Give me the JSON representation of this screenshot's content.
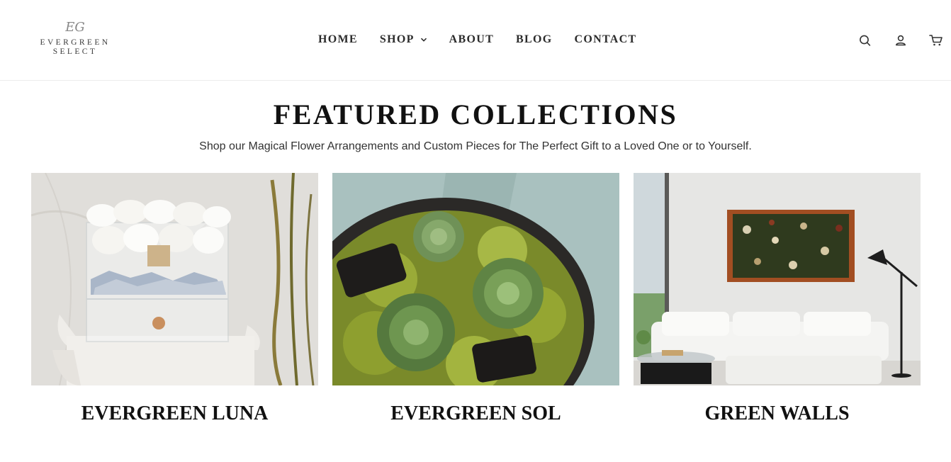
{
  "header": {
    "logo": {
      "monogram": "EG",
      "line1": "EVERGREEN",
      "line2": "SELECT"
    },
    "nav": [
      {
        "label": "HOME"
      },
      {
        "label": "SHOP"
      },
      {
        "label": "ABOUT"
      },
      {
        "label": "BLOG"
      },
      {
        "label": "CONTACT"
      }
    ],
    "icons": [
      "search-icon",
      "account-icon",
      "cart-icon"
    ]
  },
  "featured": {
    "title": "FEATURED COLLECTIONS",
    "subtitle": "Shop our Magical Flower Arrangements and Custom Pieces for The Perfect Gift to a Loved One or to Yourself.",
    "collections": [
      {
        "title": "EVERGREEN LUNA"
      },
      {
        "title": "EVERGREEN SOL"
      },
      {
        "title": "GREEN WALLS"
      }
    ]
  },
  "colors": {
    "text": "#111111",
    "nav_text": "#2b2b2b",
    "divider": "#ececec"
  }
}
